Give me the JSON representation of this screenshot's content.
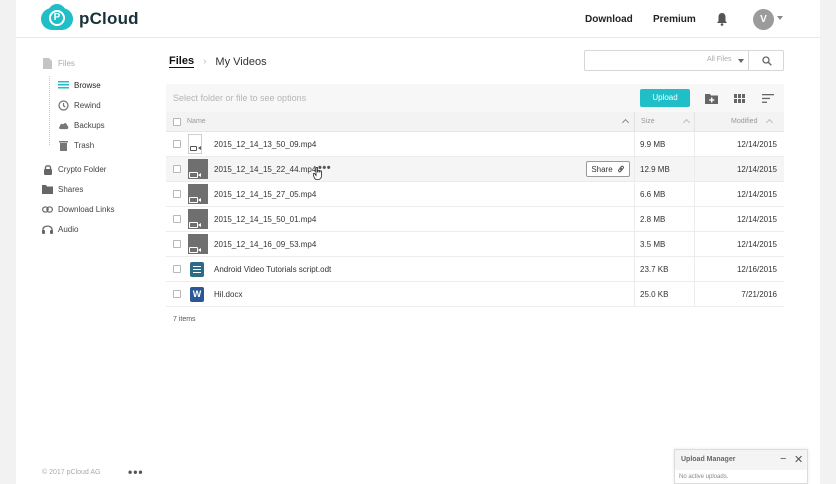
{
  "app": {
    "name": "pCloud"
  },
  "header": {
    "nav": {
      "download": "Download",
      "premium": "Premium"
    },
    "avatar_initial": "V"
  },
  "sidebar": {
    "items": [
      {
        "label": "Files",
        "icon": "file-icon"
      },
      {
        "label": "Browse",
        "icon": "list-icon"
      },
      {
        "label": "Rewind",
        "icon": "rewind-icon"
      },
      {
        "label": "Backups",
        "icon": "cloud-icon"
      },
      {
        "label": "Trash",
        "icon": "trash-icon"
      },
      {
        "label": "Crypto Folder",
        "icon": "lock-icon"
      },
      {
        "label": "Shares",
        "icon": "shared-folder-icon"
      },
      {
        "label": "Download Links",
        "icon": "link-icon"
      },
      {
        "label": "Audio",
        "icon": "headphones-icon"
      }
    ],
    "footer": "© 2017 pCloud AG",
    "more": "•••"
  },
  "breadcrumb": {
    "root": "Files",
    "current": "My Videos"
  },
  "search": {
    "filter": "All Files"
  },
  "toolbar": {
    "hint": "Select folder or file to see options",
    "upload": "Upload"
  },
  "table": {
    "columns": {
      "name": "Name",
      "size": "Size",
      "modified": "Modified"
    },
    "rows": [
      {
        "name": "2015_12_14_13_50_09.mp4",
        "size": "9.9 MB",
        "modified": "12/14/2015",
        "type": "video-empty"
      },
      {
        "name": "2015_12_14_15_22_44.mp4",
        "size": "12.9 MB",
        "modified": "12/14/2015",
        "type": "video"
      },
      {
        "name": "2015_12_14_15_27_05.mp4",
        "size": "6.6 MB",
        "modified": "12/14/2015",
        "type": "video"
      },
      {
        "name": "2015_12_14_15_50_01.mp4",
        "size": "2.8 MB",
        "modified": "12/14/2015",
        "type": "video"
      },
      {
        "name": "2015_12_14_16_09_53.mp4",
        "size": "3.5 MB",
        "modified": "12/14/2015",
        "type": "video"
      },
      {
        "name": "Android Video Tutorials script.odt",
        "size": "23.7 KB",
        "modified": "12/16/2015",
        "type": "odt"
      },
      {
        "name": "Hil.docx",
        "size": "25.0 KB",
        "modified": "7/21/2016",
        "type": "word"
      }
    ],
    "share_label": "Share",
    "row_more": "•••",
    "items_count": "7 items"
  },
  "upload_manager": {
    "title": "Upload Manager",
    "status": "No active uploads."
  },
  "colors": {
    "accent": "#20bec6"
  }
}
